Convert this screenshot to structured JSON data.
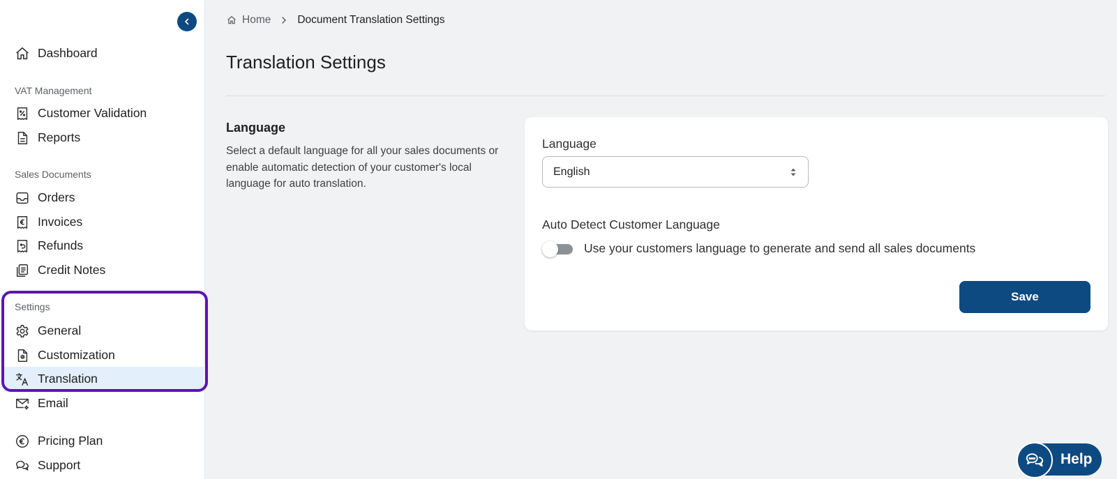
{
  "sidebar": {
    "top_items": [
      {
        "label": "Dashboard",
        "icon": "home-icon"
      }
    ],
    "sections": [
      {
        "title": "VAT Management",
        "items": [
          {
            "label": "Customer Validation",
            "icon": "receipt-percent-icon"
          },
          {
            "label": "Reports",
            "icon": "document-icon"
          }
        ]
      },
      {
        "title": "Sales Documents",
        "items": [
          {
            "label": "Orders",
            "icon": "inbox-icon"
          },
          {
            "label": "Invoices",
            "icon": "euro-receipt-icon"
          },
          {
            "label": "Refunds",
            "icon": "refund-receipt-icon"
          },
          {
            "label": "Credit Notes",
            "icon": "stacked-notes-icon"
          }
        ]
      },
      {
        "title": "Settings",
        "items": [
          {
            "label": "General",
            "icon": "gear-icon"
          },
          {
            "label": "Customization",
            "icon": "document-gear-icon"
          },
          {
            "label": "Translation",
            "icon": "translate-icon",
            "active": true
          },
          {
            "label": "Email",
            "icon": "mail-gear-icon"
          }
        ]
      }
    ],
    "bottom_items": [
      {
        "label": "Pricing Plan",
        "icon": "euro-circle-icon"
      },
      {
        "label": "Support",
        "icon": "chat-bubbles-icon"
      }
    ]
  },
  "breadcrumb": {
    "home": "Home",
    "current": "Document Translation Settings"
  },
  "page": {
    "title": "Translation Settings"
  },
  "language_section": {
    "heading": "Language",
    "description": "Select a default language for all your sales documents or enable automatic detection of your customer's local language for auto translation."
  },
  "card": {
    "language_label": "Language",
    "language_value": "English",
    "auto_detect_label": "Auto Detect Customer Language",
    "auto_detect_toggle": false,
    "auto_detect_text": "Use your customers language to generate and send all sales documents",
    "save_label": "Save"
  },
  "help": {
    "label": "Help"
  },
  "colors": {
    "primary": "#0e4a82",
    "active_bg": "#e3f0fc",
    "highlight": "#5b15b5"
  }
}
